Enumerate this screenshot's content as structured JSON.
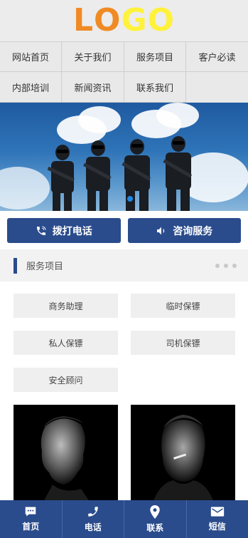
{
  "header": {
    "logo_letters": [
      {
        "char": "L",
        "color": "#f08a24"
      },
      {
        "char": "O",
        "color": "#f08a24"
      },
      {
        "char": "G",
        "color": "#fff23a"
      },
      {
        "char": "O",
        "color": "#fff23a"
      }
    ]
  },
  "nav": {
    "items": [
      {
        "label": "网站首页"
      },
      {
        "label": "关于我们"
      },
      {
        "label": "服务项目"
      },
      {
        "label": "客户必读"
      },
      {
        "label": "内部培训"
      },
      {
        "label": "新闻资讯"
      },
      {
        "label": "联系我们"
      }
    ]
  },
  "banner": {
    "active_slide": 1
  },
  "actions": {
    "call_label": "拨打电话",
    "consult_label": "咨询服务"
  },
  "section": {
    "title": "服务项目"
  },
  "services": [
    {
      "label": "商务助理"
    },
    {
      "label": "临时保镖"
    },
    {
      "label": "私人保镖"
    },
    {
      "label": "司机保镖"
    },
    {
      "label": "安全顾问"
    }
  ],
  "bottom_bar": {
    "items": [
      {
        "label": "首页",
        "icon": "chat-icon"
      },
      {
        "label": "电话",
        "icon": "phone-icon"
      },
      {
        "label": "联系",
        "icon": "location-pin-icon"
      },
      {
        "label": "短信",
        "icon": "envelope-icon"
      }
    ]
  },
  "colors": {
    "primary": "#2a4c8c",
    "logo_orange": "#f08a24",
    "logo_yellow": "#fff23a"
  }
}
